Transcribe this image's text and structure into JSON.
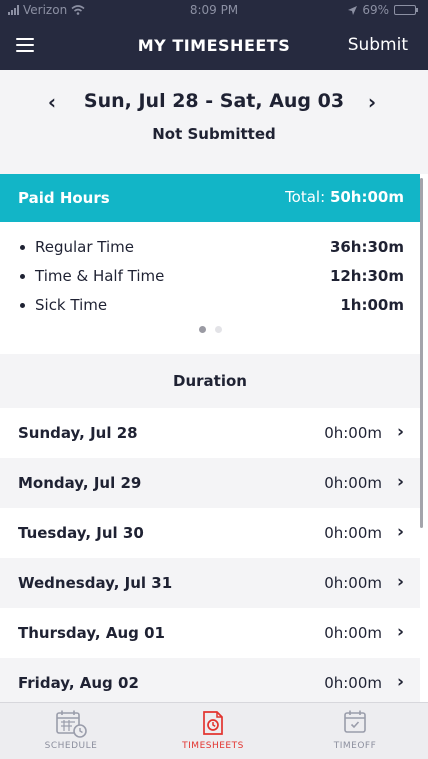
{
  "status_bar": {
    "carrier": "Verizon",
    "time": "8:09 PM",
    "battery": "69%"
  },
  "header": {
    "title": "MY TIMESHEETS",
    "submit_label": "Submit"
  },
  "week": {
    "range": "Sun, Jul 28 - Sat, Aug 03",
    "status": "Not Submitted",
    "prev_icon": "chevron-left-icon",
    "next_icon": "chevron-right-icon"
  },
  "paid_hours": {
    "title": "Paid Hours",
    "total_label": "Total:",
    "total_value": "50h:00m",
    "items": [
      {
        "label": "Regular Time",
        "value": "36h:30m"
      },
      {
        "label": "Time & Half Time",
        "value": "12h:30m"
      },
      {
        "label": "Sick Time",
        "value": "1h:00m"
      }
    ],
    "page_count": 2,
    "active_page": 0
  },
  "duration": {
    "header": "Duration",
    "days": [
      {
        "name": "Sunday, Jul 28",
        "value": "0h:00m"
      },
      {
        "name": "Monday, Jul 29",
        "value": "0h:00m"
      },
      {
        "name": "Tuesday, Jul 30",
        "value": "0h:00m"
      },
      {
        "name": "Wednesday, Jul 31",
        "value": "0h:00m"
      },
      {
        "name": "Thursday, Aug 01",
        "value": "0h:00m"
      },
      {
        "name": "Friday, Aug 02",
        "value": "0h:00m"
      }
    ]
  },
  "tabbar": {
    "tabs": [
      {
        "label": "SCHEDULE",
        "icon": "calendar-clock-icon",
        "active": false
      },
      {
        "label": "TIMESHEETS",
        "icon": "timesheet-icon",
        "active": true
      },
      {
        "label": "TIMEOFF",
        "icon": "calendar-check-icon",
        "active": false
      }
    ]
  },
  "colors": {
    "header": "#262a3f",
    "accent": "#12b5c7",
    "active_tab": "#e2342f",
    "row_alt": "#f4f4f6"
  }
}
